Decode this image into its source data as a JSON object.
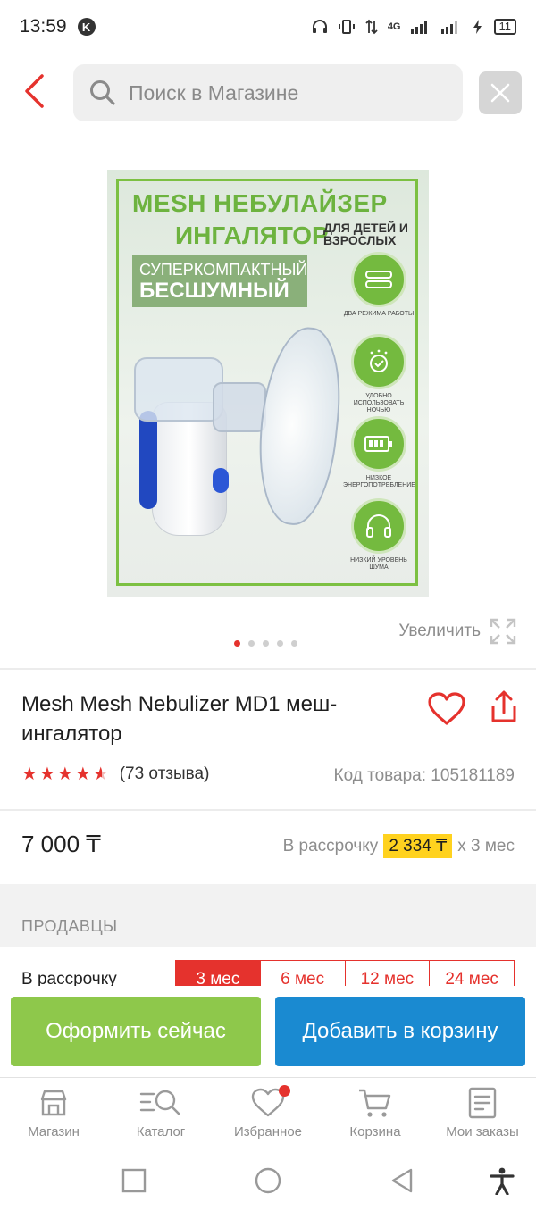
{
  "status_bar": {
    "time": "13:59",
    "network": "4G",
    "battery": "11"
  },
  "search": {
    "placeholder": "Поиск в Магазине"
  },
  "product_image": {
    "title_line1": "MESH НЕБУЛАЙЗЕР",
    "title_line2": "ИНГАЛЯТОР",
    "subtitle": "ДЛЯ ДЕТЕЙ И ВЗРОСЛЫХ",
    "badge_line1": "СУПЕРКОМПАКТНЫЙ",
    "badge_line2": "БЕСШУМНЫЙ",
    "features": [
      {
        "label": "ДВА РЕЖИМА РАБОТЫ",
        "icon": "mode-icon"
      },
      {
        "label": "УДОБНО ИСПОЛЬЗОВАТЬ НОЧЬЮ",
        "icon": "night-icon"
      },
      {
        "label": "НИЗКОЕ ЭНЕРГОПОТРЕБЛЕНИЕ",
        "icon": "battery-icon"
      },
      {
        "label": "НИЗКИЙ УРОВЕНЬ ШУМА",
        "icon": "headphones-icon"
      }
    ]
  },
  "gallery": {
    "zoom_label": "Увеличить",
    "active_index": 0,
    "count": 5
  },
  "product": {
    "title": "Mesh Mesh Nebulizer MD1 меш-ингалятор",
    "rating": 4.5,
    "reviews": "(73 отзыва)",
    "sku": "Код товара: 105181189",
    "price": "7 000 ₸",
    "installment_prefix": "В рассрочку",
    "installment_amount": "2 334 ₸",
    "installment_suffix": "х 3 мес"
  },
  "sellers": {
    "title": "ПРОДАВЦЫ",
    "installment_label": "В рассрочку",
    "tabs": [
      "3 мес",
      "6 мес",
      "12 мес",
      "24 мес"
    ],
    "active_tab": 0
  },
  "actions": {
    "buy_now": "Оформить сейчас",
    "add_to_cart": "Добавить в корзину"
  },
  "bottom_nav": {
    "items": [
      {
        "label": "Магазин",
        "icon": "store-icon"
      },
      {
        "label": "Каталог",
        "icon": "catalog-icon"
      },
      {
        "label": "Избранное",
        "icon": "heart-icon"
      },
      {
        "label": "Корзина",
        "icon": "cart-icon"
      },
      {
        "label": "Мои заказы",
        "icon": "orders-icon"
      }
    ]
  },
  "colors": {
    "accent_red": "#e5322d",
    "buy_green": "#8ec84b",
    "cart_blue": "#1a8ad1",
    "installment_yellow": "#ffd21f"
  }
}
